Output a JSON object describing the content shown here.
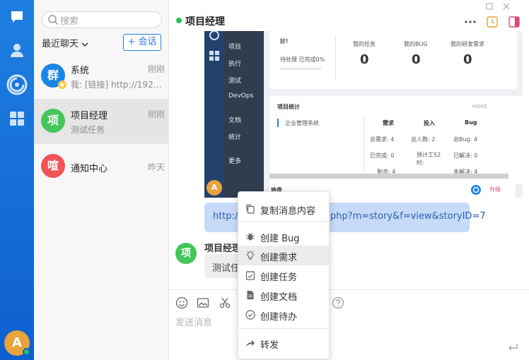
{
  "rail": {
    "user_initial": "A",
    "status_color": "#22c55e"
  },
  "sidebar": {
    "search_placeholder": "搜索",
    "recent_label": "最近聊天",
    "new_chat_label": "+ 会话",
    "conversations": [
      {
        "avatar": "群",
        "avatar_color": "#1a86e8",
        "name": "系统",
        "time": "刚刚",
        "preview": "我: [链接] http://192.16..."
      },
      {
        "avatar": "项",
        "avatar_color": "#43c659",
        "name": "项目经理",
        "time": "刚刚",
        "preview": "测试任务"
      },
      {
        "avatar": "喧",
        "avatar_color": "#f05457",
        "name": "通知中心",
        "time": "昨天",
        "preview": ""
      }
    ]
  },
  "chat": {
    "title": "项目经理",
    "link_prefix": "http://",
    "link_suffix": "php?m=story&f=view&storyID=7",
    "message2": {
      "avatar": "项",
      "sender": "项目经理",
      "text": "测试任"
    },
    "input_placeholder": "发送消息"
  },
  "shot": {
    "menu": [
      "项目",
      "执行",
      "测试",
      "DevOps",
      "文档",
      "统计",
      "更多"
    ],
    "greeting": "好!",
    "pending": "待处理 已完成0%",
    "stats": [
      {
        "label": "我的任务",
        "value": "0"
      },
      {
        "label": "我的BUG",
        "value": "0"
      },
      {
        "label": "我的研发需求",
        "value": "0"
      }
    ],
    "project_stats_title": "项目统计",
    "more": "MORE",
    "project_name": "企业管理系统",
    "cols": [
      "需求",
      "投入",
      "Bug"
    ],
    "rows": [
      [
        "总需求: 4",
        "总人数: 2",
        "总Bug: 4"
      ],
      [
        "已完成: 0",
        "预计工52时:",
        "已解决: 0"
      ],
      [
        "剩余: 4",
        "",
        "未解决: 4"
      ]
    ],
    "footer_left": "地盘",
    "upgrade": "升级",
    "avatar": "A"
  },
  "context_menu": {
    "items": [
      {
        "label": "复制消息内容",
        "icon": "copy-icon"
      },
      {
        "label": "创建 Bug",
        "icon": "bug-icon"
      },
      {
        "label": "创建需求",
        "icon": "lightbulb-icon"
      },
      {
        "label": "创建任务",
        "icon": "task-icon"
      },
      {
        "label": "创建文档",
        "icon": "document-icon"
      },
      {
        "label": "创建待办",
        "icon": "check-circle-icon"
      },
      {
        "label": "转发",
        "icon": "forward-icon"
      }
    ]
  },
  "colors": {
    "accent": "#2d7be5",
    "rail": "#1575dc",
    "online": "#22c55e",
    "link_bubble": "#c7daf8"
  }
}
